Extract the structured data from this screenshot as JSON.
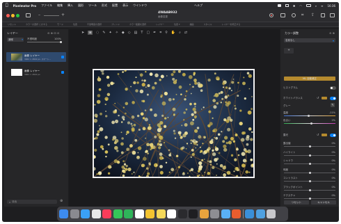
{
  "menubar": {
    "app_name": "Pixelmator Pro",
    "items": [
      "ファイル",
      "編集",
      "挿入",
      "図形",
      "ツール",
      "形式",
      "配置",
      "表示",
      "ウインドウ"
    ],
    "help": "ヘルプ",
    "clock": "16:36"
  },
  "document": {
    "title": "4WAAB932",
    "subtitle": "画像変更"
  },
  "toolbar2": {
    "items": [
      "リセット",
      "カラーの選択 とかする",
      "モード",
      "位置",
      "不透明度の選択",
      "ブレンド",
      "カラー範囲を選択",
      "レイヤー",
      "位置 ▾",
      "描画",
      "スタイル",
      "レイヤーを修正する"
    ]
  },
  "layers_panel": {
    "title": "レイヤー",
    "blend_mode": "通常",
    "opacity_label": "不透明度",
    "opacity_value": "100%",
    "layers": [
      {
        "name": "画像 レイヤー",
        "meta": "3962 × 2642 px, スマート..."
      },
      {
        "name": "画像 レイヤー",
        "meta": "3962 × 2642 px"
      }
    ],
    "search_placeholder": "検索"
  },
  "color_panel": {
    "title": "カラー調整",
    "preset": "名前なし",
    "ml_button": "ML 自動補正",
    "sections": {
      "histogram": "ヒストグラム",
      "white_balance": "ホワイトバランス",
      "gray": "グレー",
      "temperature_label": "温度",
      "temperature_value": "-11%",
      "tint_label": "色合い",
      "tint_value": "2%",
      "lightness": "露光",
      "lightness_value": "0%"
    },
    "adjustments": [
      {
        "label": "露出値",
        "value": "0%"
      },
      {
        "label": "ハイライト",
        "value": "0%"
      },
      {
        "label": "シャドウ",
        "value": "0%"
      },
      {
        "label": "明度",
        "value": "0%"
      },
      {
        "label": "コントラスト",
        "value": "0%"
      },
      {
        "label": "ブラックポイント",
        "value": "0%"
      },
      {
        "label": "テクスチャ",
        "value": "0%"
      }
    ],
    "reset_button": "リセット",
    "cancel_button": "キャンセル"
  },
  "colors": {
    "accent": "#0a84ff",
    "ml_button": "#b58a2e",
    "traffic_red": "#ff5f57",
    "traffic_yellow": "#febc2e",
    "traffic_green": "#28c840"
  },
  "dock_icons": [
    "finder-icon",
    "launchpad-icon",
    "safari-icon",
    "chrome-icon",
    "music-icon",
    "messages-icon",
    "facetime-icon",
    "calendar-icon",
    "photos-icon",
    "notes-icon",
    "reminders-icon",
    "terminal-icon",
    "activity-icon",
    "pixelmator-icon",
    "settings-icon",
    "preview-icon",
    "app-icon",
    "folder-icon",
    "downloads-icon",
    "trash-icon"
  ]
}
